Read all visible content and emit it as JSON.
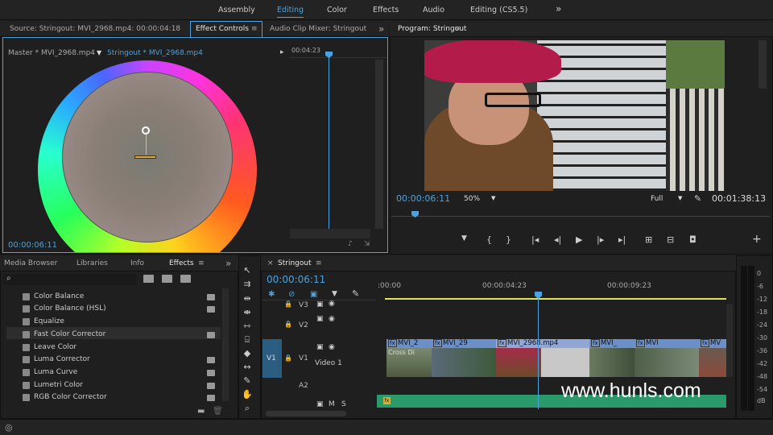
{
  "workspaces": [
    "Assembly",
    "Editing",
    "Color",
    "Effects",
    "Audio",
    "Editing (CS5.5)"
  ],
  "workspace_active": "Editing",
  "source_panel": {
    "tabs": [
      "Source: Stringout: MVI_2968.mp4: 00:00:04:18",
      "Effect Controls",
      "Audio Clip Mixer: Stringout"
    ],
    "active_tab": "Effect Controls",
    "master_label": "Master * MVI_2968.mp4",
    "sequence_label": "Stringout * MVI_2968.mp4",
    "ruler_time": "00:04:23",
    "timecode": "00:00:06:11"
  },
  "program": {
    "tab": "Program: Stringout",
    "timecode": "00:00:06:11",
    "zoom": "50%",
    "resolution": "Full",
    "duration": "00:01:38:13"
  },
  "effects_panel": {
    "tabs": [
      "Media Browser",
      "Libraries",
      "Info",
      "Effects"
    ],
    "active_tab": "Effects",
    "items": [
      "Color Balance",
      "Color Balance (HSL)",
      "Equalize",
      "Fast Color Corrector",
      "Leave Color",
      "Luma Corrector",
      "Luma Curve",
      "Lumetri Color",
      "RGB Color Corrector"
    ]
  },
  "timeline": {
    "tab": "Stringout",
    "timecode": "00:00:06:11",
    "ruler": [
      ":00:00",
      "00:00:04:23",
      "00:00:09:23"
    ],
    "tracks": {
      "v3": "V3",
      "v2": "V2",
      "v1": "V1",
      "v1_src": "V1",
      "video1": "Video 1",
      "a2": "A2",
      "m": "M",
      "s": "S"
    },
    "clips": [
      "MVI_2",
      "MVI_29",
      "MVI_2968.mp4",
      "MVI_",
      "MVI",
      "MV"
    ],
    "transition": "Cross Di"
  },
  "meter_labels": [
    "0",
    "-6",
    "-12",
    "-18",
    "-24",
    "-30",
    "-36",
    "-42",
    "-48",
    "-54"
  ],
  "meter_unit": "dB",
  "watermark": "www.hunls.com",
  "colors": {
    "accent": "#4aa3e0",
    "clip": "#6b8fc8",
    "audio": "#2a9a6a",
    "workarea": "#e3e34a"
  }
}
